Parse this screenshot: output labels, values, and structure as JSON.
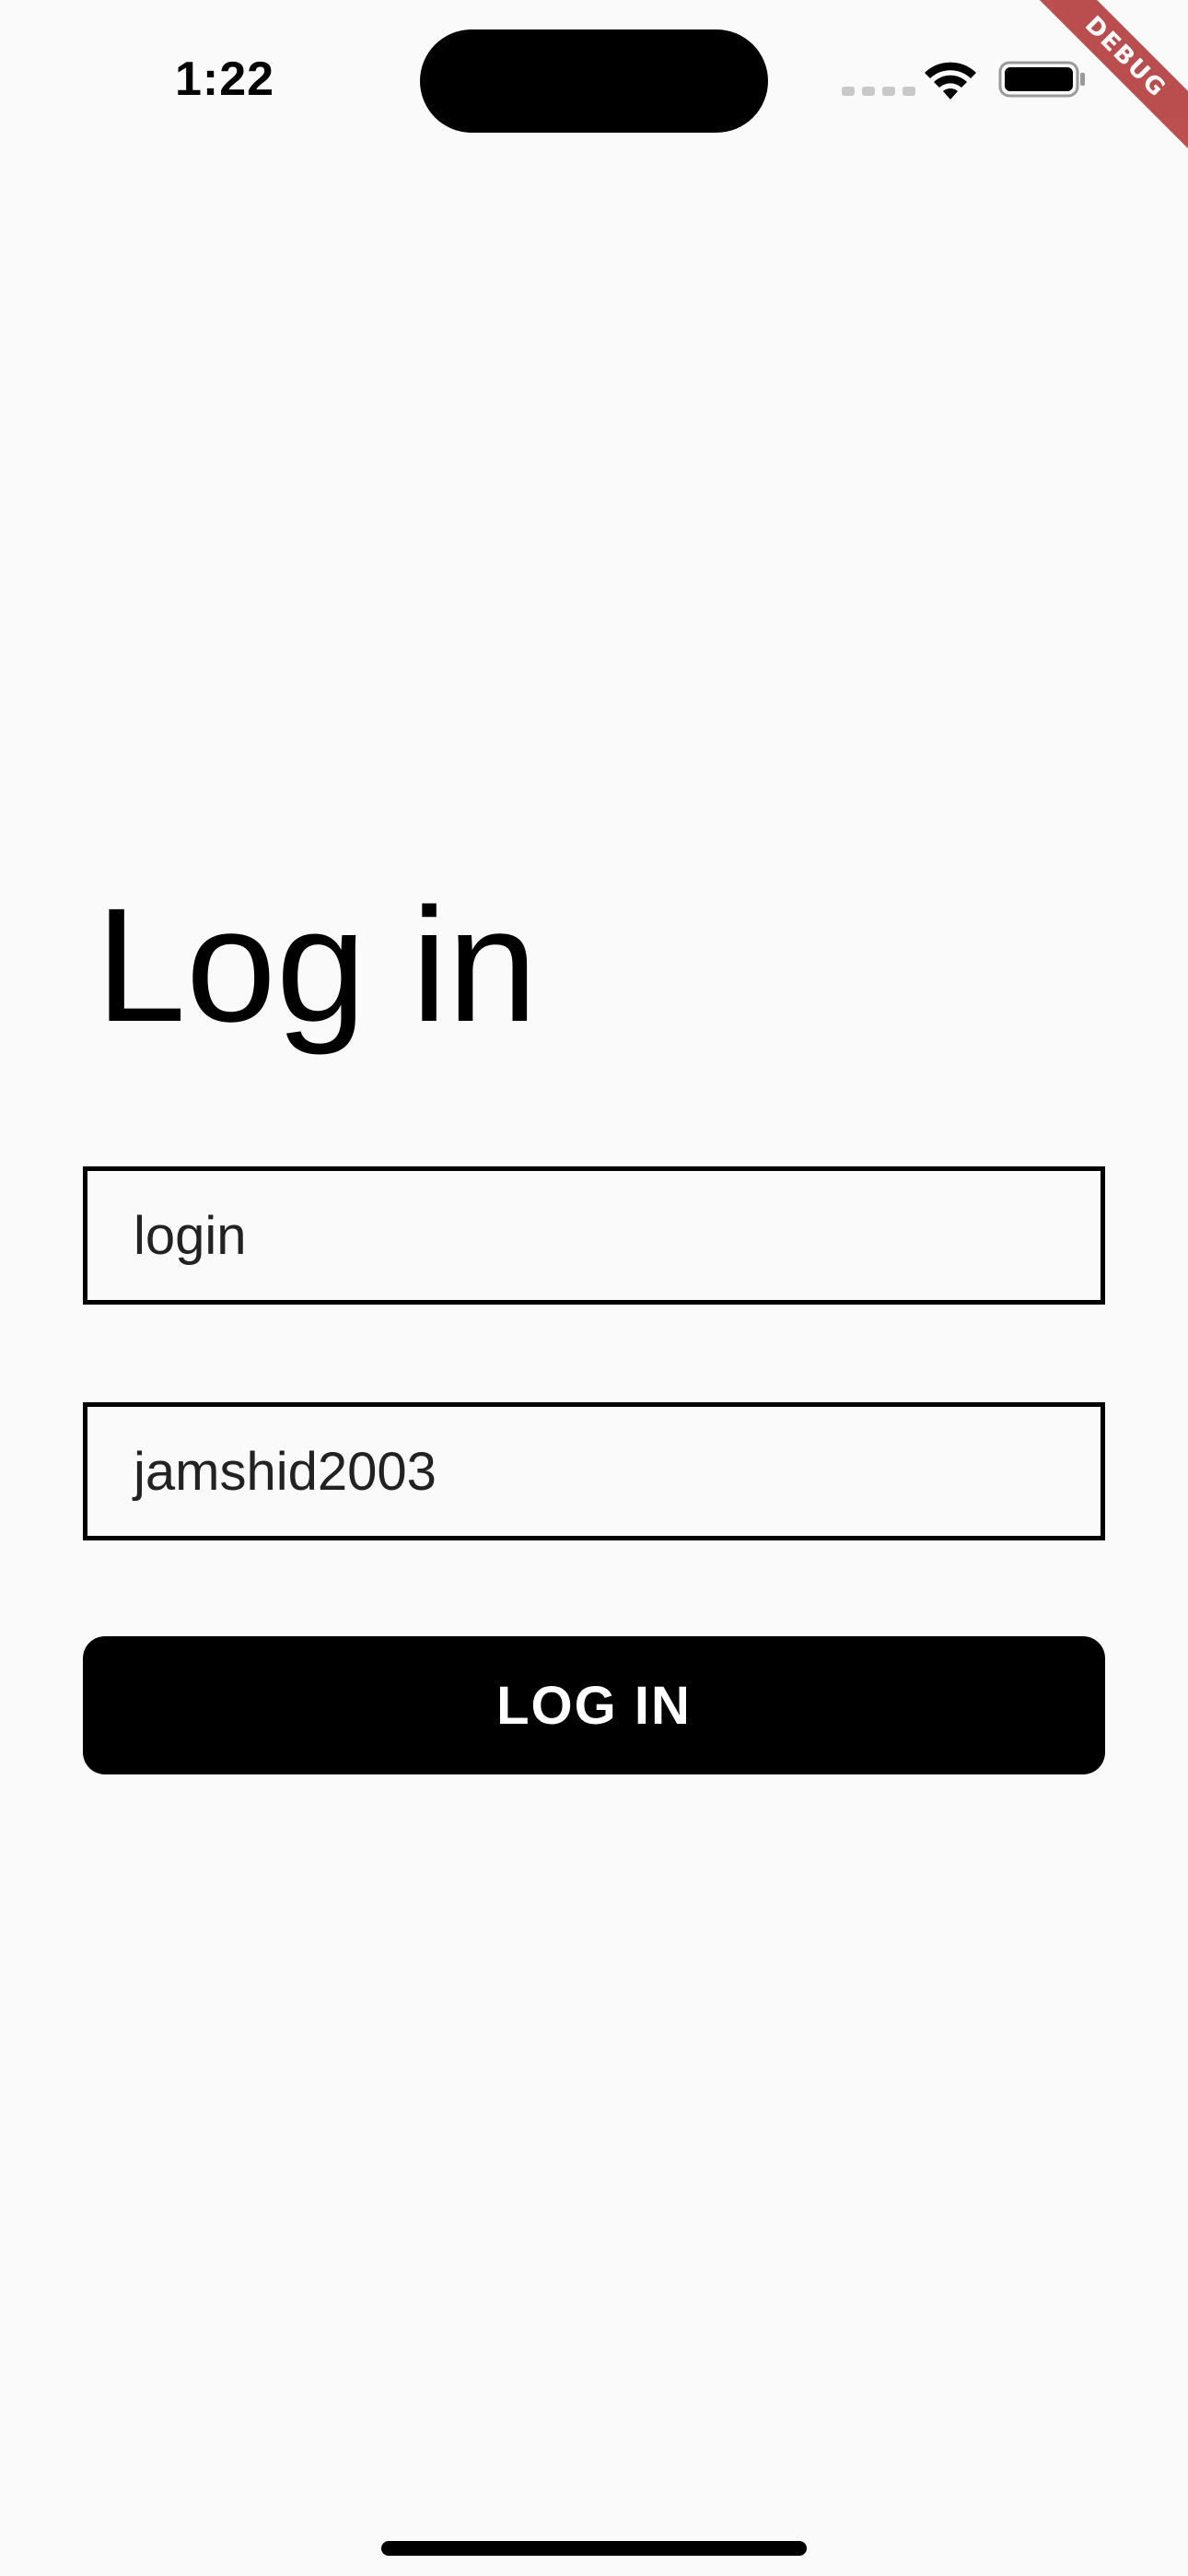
{
  "status_bar": {
    "time": "1:22",
    "icons": [
      "cellular-signal-icon",
      "wifi-icon",
      "battery-icon"
    ]
  },
  "debug_banner": {
    "label": "DEBUG",
    "color": "#b03030"
  },
  "login_form": {
    "title": "Log in",
    "login_field": {
      "placeholder": "login",
      "value": ""
    },
    "password_field": {
      "value": "jamshid2003"
    },
    "submit_label": "LOG IN"
  },
  "colors": {
    "background": "#fafafa",
    "button": "#000000",
    "button_text": "#ffffff",
    "border": "#000000"
  }
}
